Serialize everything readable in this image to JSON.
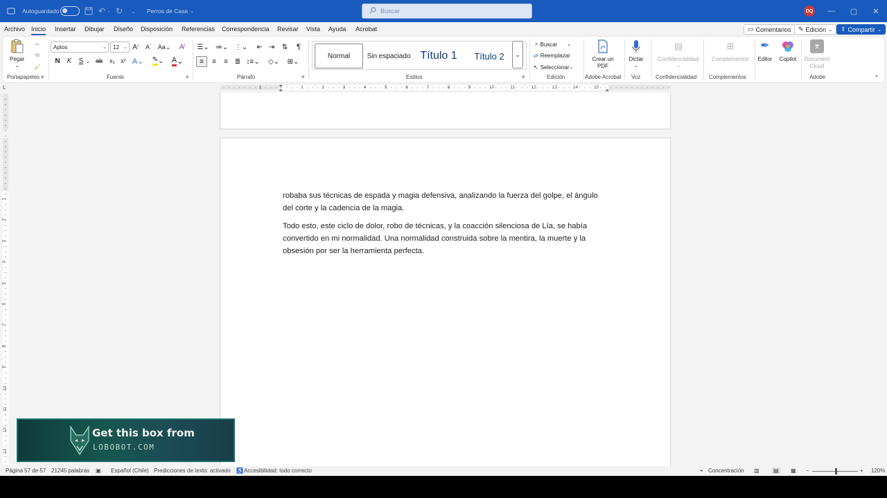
{
  "titlebar": {
    "autosave_label": "Autoguardado",
    "doc_name": "Perros de Casa",
    "search_placeholder": "Buscar",
    "user_initials": "DQ"
  },
  "menu": {
    "tabs": [
      "Archivo",
      "Inicio",
      "Insertar",
      "Dibujar",
      "Diseño",
      "Disposición",
      "Referencias",
      "Correspondencia",
      "Revisar",
      "Vista",
      "Ayuda",
      "Acrobat"
    ],
    "active_tab": "Inicio",
    "comments_label": "Comentarios",
    "editing_label": "Edición",
    "share_label": "Compartir"
  },
  "ribbon": {
    "clipboard": {
      "paste_label": "Pegar",
      "group": "Portapapeles"
    },
    "font": {
      "font_name": "Aptos",
      "font_size": "12",
      "group": "Fuente"
    },
    "paragraph": {
      "group": "Párrafo"
    },
    "styles": {
      "group": "Estilos",
      "items": [
        "Normal",
        "Sin espaciado",
        "Título 1",
        "Título 2"
      ]
    },
    "editing": {
      "group": "Edición",
      "find": "Buscar",
      "replace": "Reemplazar",
      "select": "Seleccionar"
    },
    "acrobat": {
      "create_pdf": "Crear un PDF",
      "group": "Adobe Acrobat"
    },
    "voice": {
      "dictate": "Dictar",
      "group": "Voz"
    },
    "confidentiality": {
      "label": "Confidencialidad",
      "group": "Confidencialidad"
    },
    "addins": {
      "label": "Complementos",
      "group": "Complementos"
    },
    "editor": {
      "label": "Editor"
    },
    "copilot": {
      "label": "Copilot"
    },
    "adobe": {
      "label": "Document Cloud",
      "group": "Adobe"
    }
  },
  "ruler": {
    "numbers": [
      "1",
      "1",
      "2",
      "3",
      "4",
      "5",
      "6",
      "7",
      "8",
      "9",
      "10",
      "11",
      "12",
      "13",
      "14",
      "15"
    ],
    "vnumbers": [
      "1",
      "2",
      "3",
      "4",
      "5",
      "6",
      "7",
      "8",
      "9",
      "10",
      "11",
      "12",
      "13"
    ]
  },
  "document": {
    "paragraph1": "robaba sus técnicas de espada y magia defensiva, analizando la fuerza del golpe, el ángulo del corte y la cadencia de la magia.",
    "paragraph2": "Todo esto, este ciclo de dolor, robo de técnicas, y la coacción silenciosa de Lía, se había convertido en mi normalidad. Una normalidad construida sobre la mentira, la muerte y la obsesión por ser la herramienta perfecta."
  },
  "ad": {
    "line1": "Get this box from",
    "line2": "LOBOBOT.COM"
  },
  "status": {
    "page": "Página 57 de 57",
    "words": "21245 palabras",
    "language": "Español (Chile)",
    "predictions": "Predicciones de texto: activado",
    "accessibility": "Accesibilidad: todo correcto",
    "focus": "Concentración",
    "zoom": "120%"
  },
  "colors": {
    "accent": "#185abd",
    "avatar": "#c43b3b"
  }
}
